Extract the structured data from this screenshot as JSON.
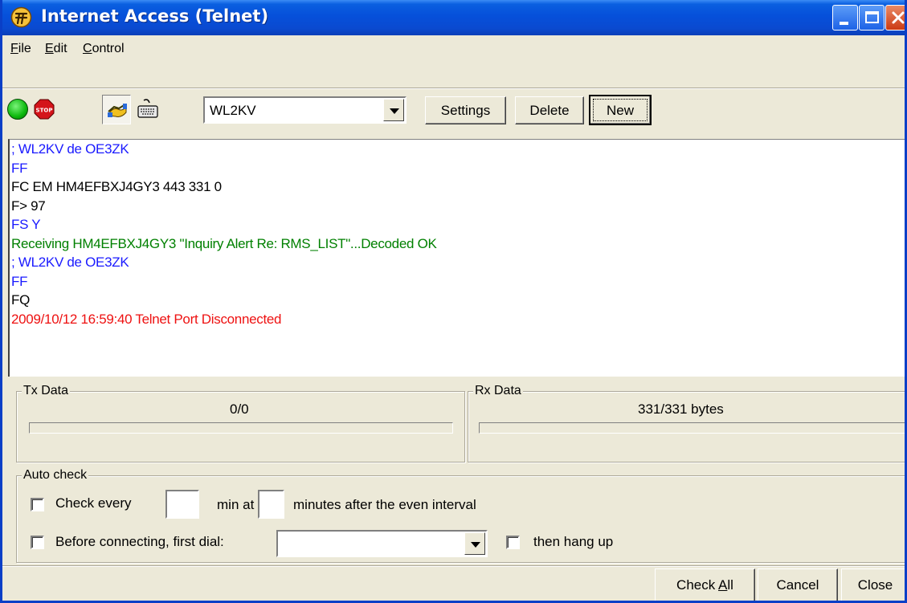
{
  "window": {
    "title": "Internet Access (Telnet)"
  },
  "menu": {
    "items": [
      {
        "label": "File",
        "mnemonic": "F",
        "rest": "ile"
      },
      {
        "label": "Edit",
        "mnemonic": "E",
        "rest": "dit"
      },
      {
        "label": "Control",
        "mnemonic": "C",
        "rest": "ontrol"
      }
    ]
  },
  "toolbar": {
    "connect_icon": "green-circle-icon",
    "stop_icon": "stop-sign-icon",
    "handshake_icon": "handshake-icon",
    "keyboard_icon": "keyboard-icon",
    "station_select": "WL2KV",
    "settings_label": "Settings",
    "delete_label": "Delete",
    "new_label": "New"
  },
  "session_log": {
    "lines": [
      {
        "text": "; WL2KV de OE3ZK",
        "color": "#1a1aff"
      },
      {
        "text": "FF",
        "color": "#1a1aff"
      },
      {
        "text": "FC EM HM4EFBXJ4GY3 443 331 0",
        "color": "#000000"
      },
      {
        "text": "F> 97",
        "color": "#000000"
      },
      {
        "text": "FS Y",
        "color": "#1a1aff"
      },
      {
        "text": "Receiving HM4EFBXJ4GY3 \"Inquiry Alert Re: RMS_LIST\"...Decoded OK",
        "color": "#008000"
      },
      {
        "text": "; WL2KV de OE3ZK",
        "color": "#1a1aff"
      },
      {
        "text": "FF",
        "color": "#1a1aff"
      },
      {
        "text": "FQ",
        "color": "#000000"
      },
      {
        "text": "2009/10/12 16:59:40 Telnet Port Disconnected",
        "color": "#ee1111"
      }
    ]
  },
  "tx": {
    "label": "Tx Data",
    "value": "0/0",
    "progress": 0
  },
  "rx": {
    "label": "Rx Data",
    "value": "331/331 bytes",
    "progress": 0
  },
  "auto_check": {
    "label": "Auto check",
    "check_every_label": "Check every",
    "check_every_value": "",
    "min_at_label": "min at",
    "min_at_value": "",
    "minutes_after_label": "minutes after the even interval",
    "dial_label": "Before connecting, first dial:",
    "dial_value": "",
    "hang_up_label": "then hang up"
  },
  "footer": {
    "check_all_label": "Check All",
    "check_all_mnemonic": "A",
    "cancel_label": "Cancel",
    "close_label": "Close"
  },
  "colors": {
    "title_bar": "#0a4ad0",
    "window_bg": "#ece9d8",
    "log_blue": "#1a1aff",
    "log_green": "#008000",
    "log_red": "#ee1111"
  }
}
